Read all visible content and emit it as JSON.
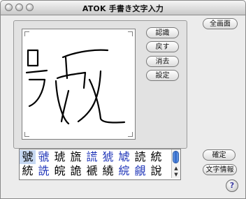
{
  "window": {
    "title": "ATOK 手書き文字入力"
  },
  "buttons": {
    "fullscreen": "全画面",
    "recognize": "認識",
    "undo": "戻す",
    "erase": "消去",
    "settings": "設定",
    "confirm": "確定",
    "char_info": "文字情報",
    "help": "?"
  },
  "candidates": {
    "row1": [
      "號",
      "虢",
      "琥",
      "旒",
      "謊",
      "猇",
      "虓",
      "読",
      "統"
    ],
    "row2": [
      "統",
      "詵",
      "皖",
      "詭",
      "褫",
      "繞",
      "綄",
      "覦",
      "說"
    ],
    "blue_row1": [
      false,
      true,
      false,
      false,
      true,
      true,
      true,
      false,
      false
    ],
    "blue_row2": [
      false,
      true,
      false,
      false,
      false,
      false,
      true,
      true,
      false
    ],
    "selected_index": 0
  },
  "scrollbar": {
    "up_arrow": "▲",
    "down_arrow": "▼"
  }
}
